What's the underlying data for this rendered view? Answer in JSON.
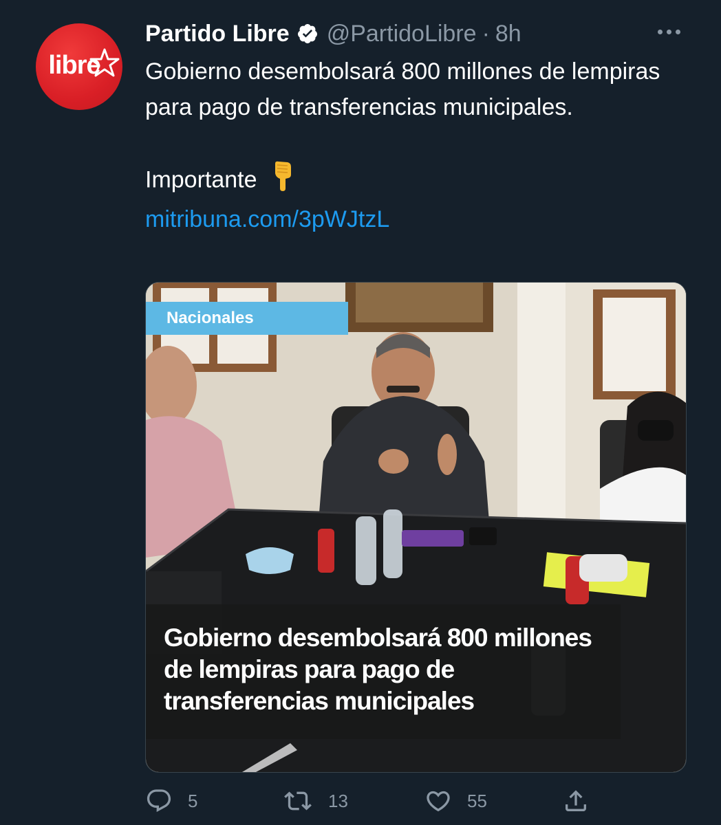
{
  "tweet": {
    "author": {
      "display_name": "Partido Libre",
      "handle": "@PartidoLibre",
      "verified": true,
      "avatar_text": "libre",
      "avatar_color": "#d91f26"
    },
    "separator": "·",
    "timestamp": "8h",
    "text_line1": "Gobierno desembolsará 800 millones de lempiras para pago de transferencias municipales.",
    "text_line2": "Importante",
    "emoji": "backhand-index-pointing-down",
    "link": "mitribuna.com/3pWJtzL"
  },
  "card": {
    "tag": "Nacionales",
    "tag_color": "#5db8e4",
    "headline": "Gobierno desembolsará 800 millones de lempiras para pago de transferencias municipales"
  },
  "actions": {
    "replies": "5",
    "retweets": "13",
    "likes": "55"
  },
  "colors": {
    "background": "#15202b",
    "text": "#ffffff",
    "muted": "#8b98a5",
    "link": "#1d9bf0"
  }
}
